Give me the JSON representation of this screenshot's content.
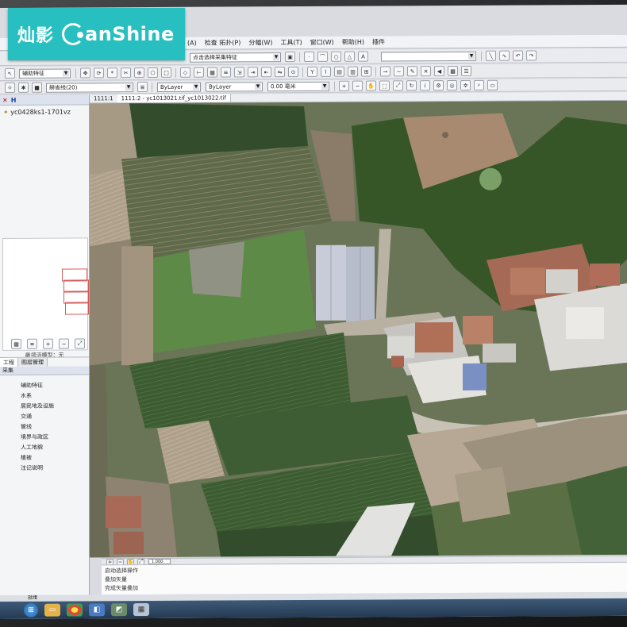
{
  "brand": {
    "cn_name": "灿影",
    "en_name": "anShine",
    "accent": "#27bfbf"
  },
  "menus": [
    "(A)",
    "检查 拓扑(P)",
    "分幅(W)",
    "工具(T)",
    "窗口(W)",
    "帮助(H)",
    "插件"
  ],
  "toolbar1": {
    "select_feature_placeholder": "点击选择采集特征"
  },
  "toolbar2": {
    "aux_feature_combo": "辅助特征"
  },
  "toolbar3": {
    "layer_combo": "赫省线(20)",
    "bylayer_color": "ByLayer",
    "bylayer_linetype": "ByLayer",
    "lineweight": "0.00 毫米"
  },
  "left_panel": {
    "root_label": "H",
    "tree_item": "yc0428ks1-1701vz",
    "preview_caption": "最领活模型：无",
    "tabs": [
      "工程",
      "图层管理"
    ],
    "category_header": "采集",
    "categories": [
      "辅助特征",
      "水系",
      "居民地及设施",
      "交通",
      "管线",
      "境界与政区",
      "人工地貌",
      "植被",
      "注记说明"
    ]
  },
  "doc_tabs": [
    {
      "label": "1111:1",
      "active": false
    },
    {
      "label": "1111:2 - yc1013021.tif_yc1013022.tif",
      "active": true
    }
  ],
  "bottom_bar": {
    "zoom": "1.000"
  },
  "command_log": [
    "启动选择操作",
    "叠加矢量",
    "完成矢量叠加"
  ],
  "status_text": "就绪",
  "map_colors": {
    "field_green": "#4d6e3a",
    "field_dark": "#324a2a",
    "soil": "#a89a86",
    "forest": "#3a5a2a",
    "roof_red": "#b07058",
    "roof_white": "#d8d8d4",
    "greenhouse": "#c8ccd8"
  }
}
